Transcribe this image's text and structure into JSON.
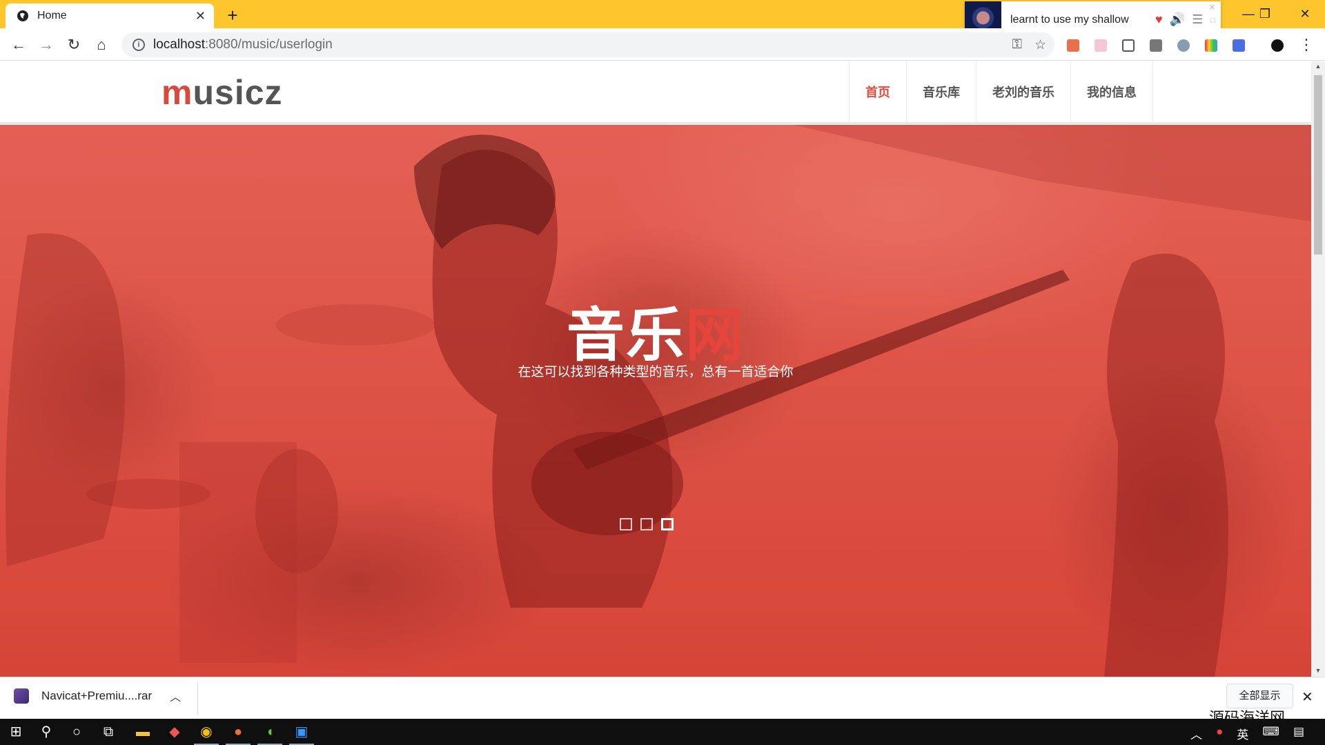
{
  "browser": {
    "tab_title": "Home",
    "tab_close": "✕",
    "new_tab": "+",
    "url_host": "localhost",
    "url_rest": ":8080/music/userlogin",
    "window_controls": {
      "minimize": "—",
      "restore": "❐",
      "close": "✕"
    }
  },
  "miniplayer": {
    "track": "learnt to use my shallow",
    "heart": "♥",
    "volume": "🔊",
    "list": "☰"
  },
  "site": {
    "logo_first": "m",
    "logo_rest": "usicz",
    "nav": [
      "首页",
      "音乐库",
      "老刘的音乐",
      "我的信息"
    ],
    "active_nav": 0,
    "accent_color": "#e24b3f"
  },
  "hero": {
    "title_main": "音乐",
    "title_accent": "网",
    "subtitle": "在这可以找到各种类型的音乐，总有一首适合你",
    "slides": 3,
    "active_slide": 2
  },
  "downloads": {
    "file_name": "Navicat+Premiu....rar",
    "show_all": "全部显示",
    "close": "✕"
  },
  "taskbar": {
    "tray_lang": "英",
    "watermark": "源码海洋网"
  }
}
